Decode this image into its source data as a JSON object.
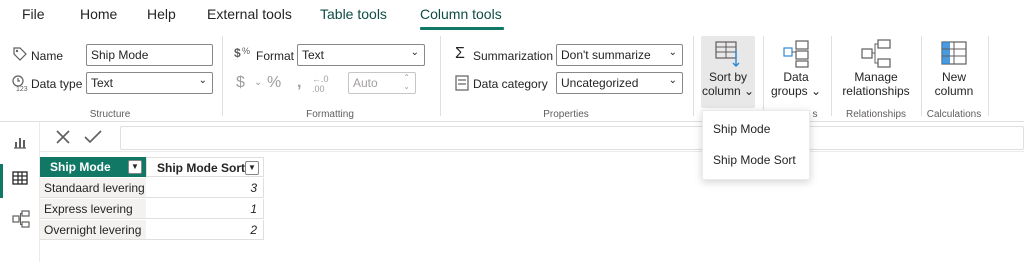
{
  "tabs": [
    {
      "label": "File",
      "contextual": false
    },
    {
      "label": "Home",
      "contextual": false
    },
    {
      "label": "Help",
      "contextual": false
    },
    {
      "label": "External tools",
      "contextual": false
    },
    {
      "label": "Table tools",
      "contextual": true
    },
    {
      "label": "Column tools",
      "contextual": true,
      "selected": true
    }
  ],
  "structure": {
    "name_label": "Name",
    "name_value": "Ship Mode",
    "datatype_label": "Data type",
    "datatype_value": "Text",
    "group_label": "Structure"
  },
  "formatting": {
    "format_label": "Format",
    "format_value": "Text",
    "decimal_value": "Auto",
    "group_label": "Formatting"
  },
  "properties": {
    "summarization_label": "Summarization",
    "summarization_value": "Don't summarize",
    "category_label": "Data category",
    "category_value": "Uncategorized",
    "group_label": "Properties"
  },
  "buttons": {
    "sort_by": {
      "line1": "Sort by",
      "line2": "column"
    },
    "data_groups": {
      "line1": "Data",
      "line2": "groups"
    },
    "manage_rel": {
      "line1": "Manage",
      "line2": "relationships"
    },
    "new_column": {
      "line1": "New",
      "line2": "column"
    }
  },
  "group_labels": {
    "groups_partial": "s",
    "relationships": "Relationships",
    "calculations": "Calculations"
  },
  "sort_menu": {
    "items": [
      "Ship Mode",
      "Ship Mode Sort"
    ]
  },
  "table": {
    "columns": [
      "Ship Mode",
      "Ship Mode Sort"
    ],
    "rows": [
      {
        "mode": "Standaard levering",
        "sort": "3"
      },
      {
        "mode": "Express levering",
        "sort": "1"
      },
      {
        "mode": "Overnight levering",
        "sort": "2"
      }
    ]
  },
  "colors": {
    "accent": "#117865",
    "contextual_tab": "#0e4c45",
    "icon_blue": "#2b88d8"
  },
  "icons": [
    "tag-icon",
    "datatype-icon",
    "format-icon",
    "summation-icon",
    "data-category-icon",
    "sort-by-column-icon",
    "data-groups-icon",
    "manage-relationships-icon",
    "new-column-icon",
    "report-view-icon",
    "data-view-icon",
    "model-view-icon",
    "cancel-icon",
    "commit-icon",
    "filter-icon"
  ]
}
